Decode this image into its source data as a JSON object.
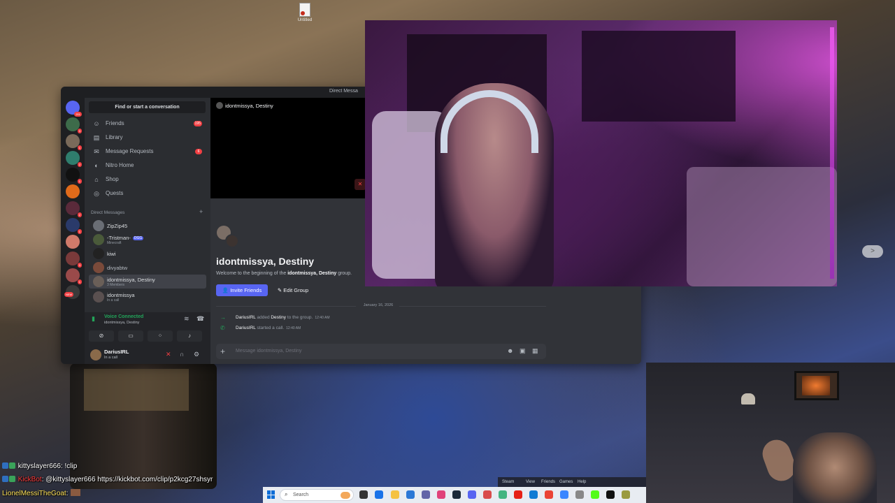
{
  "desktop": {
    "icon_label": "Untitled"
  },
  "discord": {
    "titlebar_label": "Direct Messa",
    "find_placeholder": "Find or start a conversation",
    "nav": [
      {
        "label": "Friends",
        "count": "195"
      },
      {
        "label": "Library"
      },
      {
        "label": "Message Requests",
        "count": "6"
      },
      {
        "label": "Nitro Home"
      },
      {
        "label": "Shop"
      },
      {
        "label": "Quests"
      }
    ],
    "guild_badges": [
      "201",
      "3",
      "1",
      "2",
      "1",
      "2",
      "1",
      "3",
      "1",
      "NEW"
    ],
    "dm_header": "Direct Messages",
    "dms": [
      {
        "name": "ZipZip45",
        "sub": ""
      },
      {
        "name": "-Tristman-",
        "tag": "DGG",
        "sub": "Minecraft"
      },
      {
        "name": "kiwi",
        "sub": ""
      },
      {
        "name": "divyabtw",
        "sub": ""
      },
      {
        "name": "idontmissya, Destiny",
        "sub": "3 Members"
      },
      {
        "name": "idontmissya",
        "sub": "In a call"
      }
    ],
    "voice": {
      "status": "Voice Connected",
      "channel": "idontmissya, Destiny"
    },
    "user": {
      "name": "DariusIRL",
      "status": "In a call"
    },
    "call_header": "idontmissya, Destiny",
    "group_name": "idontmissya, Destiny",
    "welcome_prefix": "Welcome to the beginning of the ",
    "welcome_group": "idontmissya, Destiny",
    "welcome_suffix": " group.",
    "invite_label": "Invite Friends",
    "edit_label": "Edit Group",
    "date_label": "January 16, 2026",
    "messages": [
      {
        "user": "DariusIRL",
        "mid": " added ",
        "target": "Destiny",
        "rest": " to the group.",
        "time": "12:40 AM"
      },
      {
        "user": "DariusIRL",
        "mid": " started a call.",
        "target": "",
        "rest": "",
        "time": "12:40 AM"
      }
    ],
    "composer_placeholder": "Message idontmissya, Destiny"
  },
  "chat": [
    {
      "user": "kittyslayer666",
      "text": ": !clip"
    },
    {
      "user": "KickBot",
      "text": ": @kittyslayer666 https://kickbot.com/clip/p2kcg27shsyr"
    },
    {
      "user": "LionelMessiTheGoat",
      "text": ":"
    }
  ],
  "taskbar": {
    "search_placeholder": "Search"
  },
  "steam": {
    "items": [
      "Steam",
      "View",
      "Friends",
      "Games",
      "Help"
    ]
  },
  "colors": {
    "discord_blurple": "#5865f2",
    "voice_green": "#23a55a",
    "danger_red": "#f23f43"
  }
}
